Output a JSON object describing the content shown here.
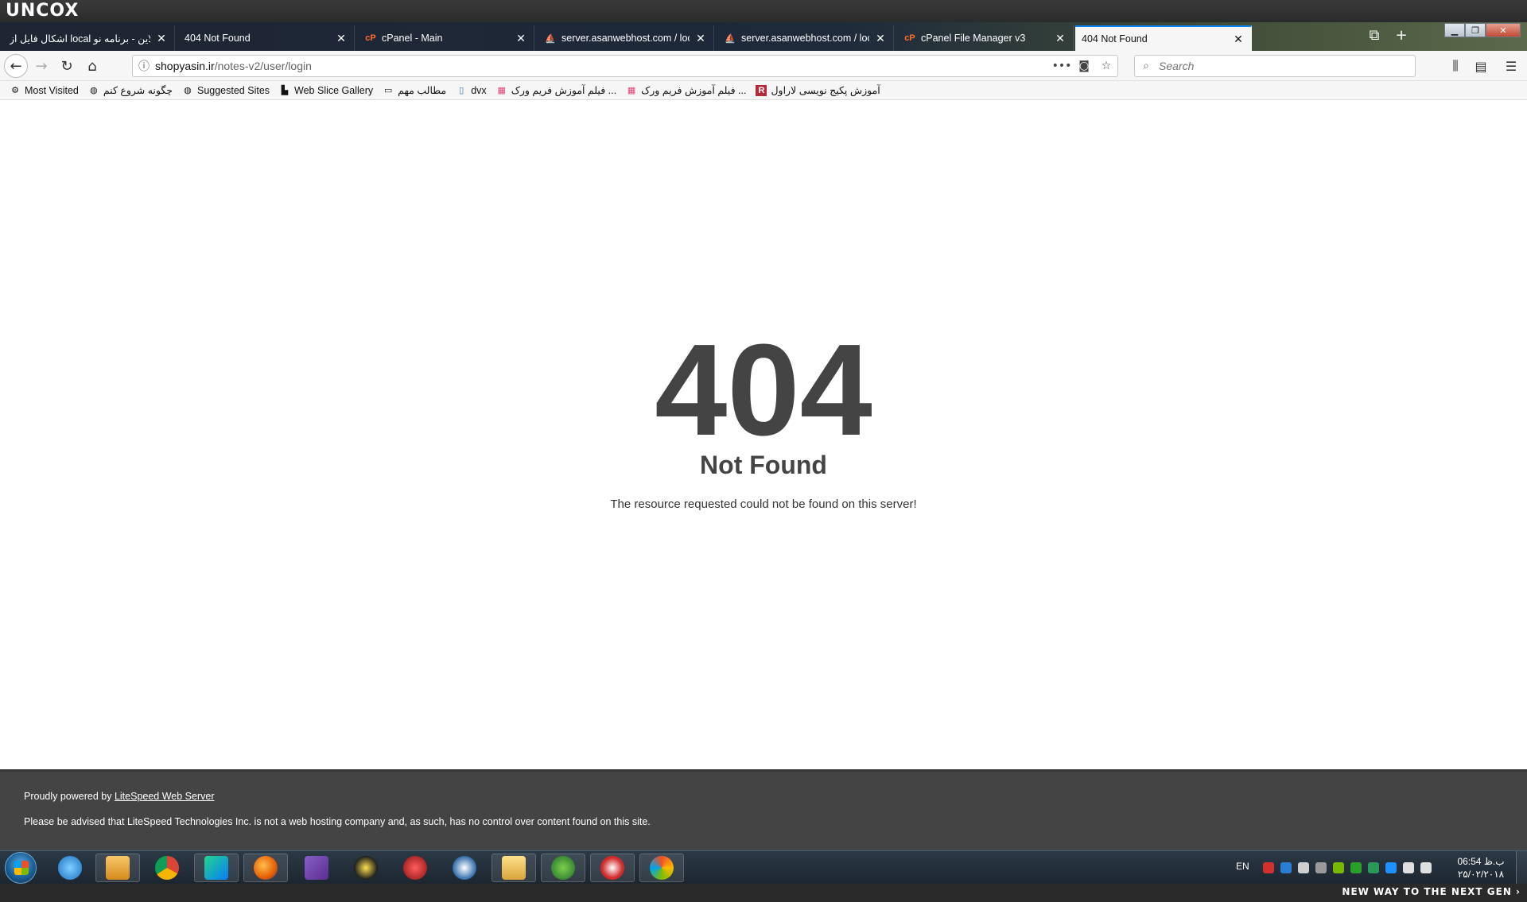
{
  "brand": {
    "logo_text": "UNCOX",
    "tagline": "NEW WAY TO THE NEXT GEN ›"
  },
  "tabs": [
    {
      "label": "اشکال فایل از local به انلاین - برنامه نو",
      "favicon": "",
      "active": false
    },
    {
      "label": "404 Not Found",
      "favicon": "",
      "active": false
    },
    {
      "label": "cPanel - Main",
      "favicon": "cpanel-icon",
      "active": false
    },
    {
      "label": "server.asanwebhost.com / loca",
      "favicon": "phpmyadmin-icon",
      "active": false
    },
    {
      "label": "server.asanwebhost.com / loca",
      "favicon": "phpmyadmin-icon",
      "active": false
    },
    {
      "label": "cPanel File Manager v3",
      "favicon": "cpanel-icon",
      "active": false
    },
    {
      "label": "404 Not Found",
      "favicon": "",
      "active": true
    }
  ],
  "navbar": {
    "url_host": "shopyasin.ir",
    "url_path": "/notes-v2/user/login",
    "search_placeholder": "Search",
    "page_actions": "•••"
  },
  "bookmarks": [
    {
      "label": "Most Visited",
      "icon": "gear-icon"
    },
    {
      "label": "چگونه شروع کنم",
      "icon": "globe-icon"
    },
    {
      "label": "Suggested Sites",
      "icon": "globe-icon"
    },
    {
      "label": "Web Slice Gallery",
      "icon": "web-slice-icon"
    },
    {
      "label": "مطالب مهم",
      "icon": "folder-icon"
    },
    {
      "label": "dvx",
      "icon": "page-icon"
    },
    {
      "label": "فیلم آموزش فریم ورک ...",
      "icon": "grid-icon"
    },
    {
      "label": "فیلم آموزش فریم ورک ...",
      "icon": "grid-icon"
    },
    {
      "label": "آموزش پکیج نویسی لاراول",
      "icon": "r-icon"
    }
  ],
  "page": {
    "code": "404",
    "title": "Not Found",
    "message": "The resource requested could not be found on this server!"
  },
  "footer": {
    "powered_prefix": "Proudly powered by ",
    "powered_link": "LiteSpeed Web Server",
    "disclaimer": "Please be advised that LiteSpeed Technologies Inc. is not a web hosting company and, as such, has no control over content found on this site."
  },
  "taskbar": {
    "lang": "EN",
    "time": "06:54 ب.ظ",
    "date": "۲۵/۰۲/۲۰۱۸",
    "apps": [
      "internet-explorer-icon",
      "media-player-icon",
      "chrome-icon",
      "jetbrains-icon",
      "firefox-icon",
      "visual-studio-icon",
      "browser-icon",
      "app-icon",
      "app-icon",
      "file-explorer-icon",
      "globe-download-icon",
      "media-icon",
      "paint-icon"
    ]
  },
  "colors": {
    "accent": "#0a84ff",
    "heading": "#444444",
    "footer_bg": "#444444"
  }
}
